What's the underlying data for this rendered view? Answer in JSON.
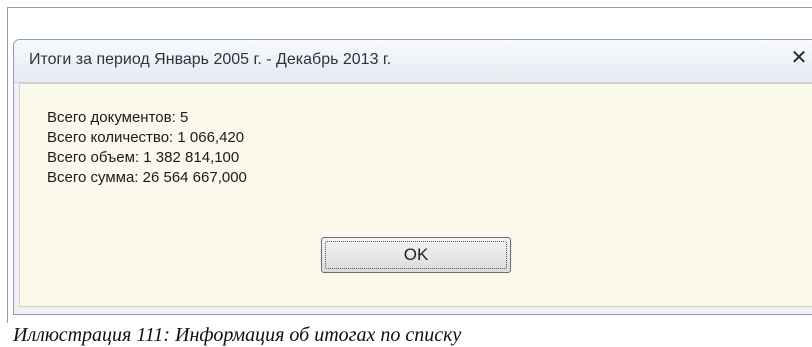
{
  "dialog": {
    "title": "Итоги за период Январь 2005 г. - Декабрь 2013 г.",
    "close_glyph": "✕",
    "lines": [
      "Всего документов: 5",
      "Всего количество: 1 066,420",
      "Всего объем: 1 382 814,100",
      "Всего сумма: 26 564 667,000"
    ],
    "ok_label": "OK"
  },
  "caption": "Иллюстрация 111: Информация об итогах по списку"
}
